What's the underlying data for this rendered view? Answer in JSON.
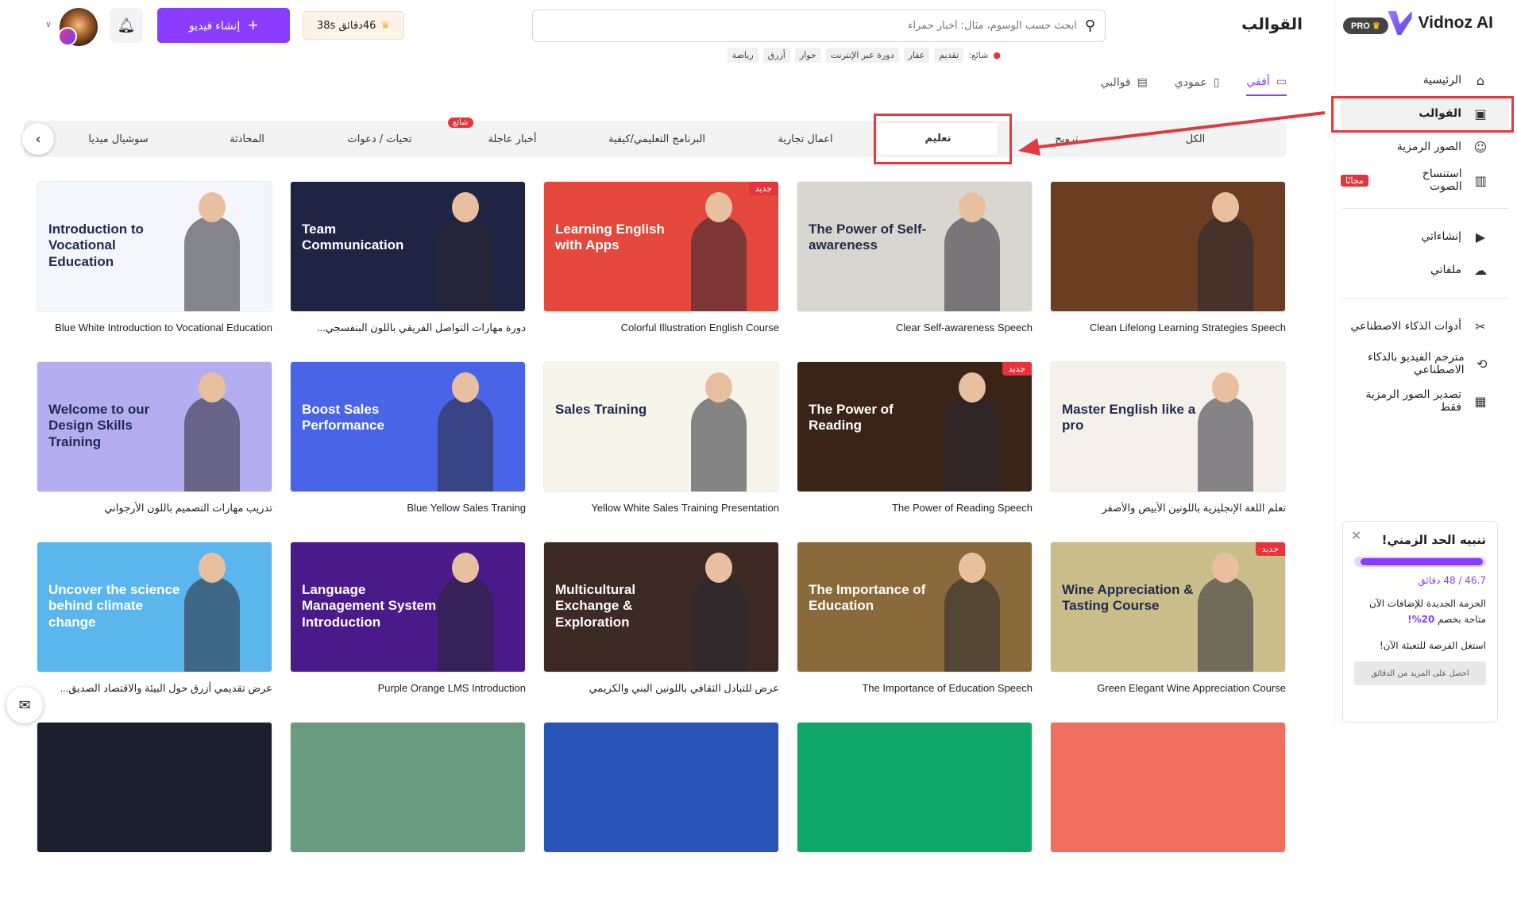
{
  "app": {
    "logo": "Vidnoz AI",
    "pro": "PRO",
    "page_title": "القوالب"
  },
  "search": {
    "placeholder": "ابحث حسب الوسوم، مثال: أخبار حمراء",
    "trending_label": "شائع:",
    "tags": [
      "تقديم",
      "عقار",
      "دورة عبر الإنترنت",
      "حوار",
      "أزرق",
      "رياضة"
    ]
  },
  "header": {
    "credits": "46دقائق 38s",
    "create_label": "إنشاء فيديو"
  },
  "sidebar": {
    "items": [
      {
        "label": "الرئيسية",
        "icon": "home-icon",
        "glyph": "⌂"
      },
      {
        "label": "القوالب",
        "icon": "templates-icon",
        "glyph": "▣",
        "active": true
      },
      {
        "label": "الصور الرمزية",
        "icon": "avatar-icon",
        "glyph": "☺"
      },
      {
        "label": "استنساخ الصوت",
        "icon": "voice-icon",
        "glyph": "▥",
        "badge": "مجانًا"
      },
      {
        "label": "إنشاءاتي",
        "icon": "play-icon",
        "glyph": "▶"
      },
      {
        "label": "ملفاتي",
        "icon": "upload-cloud-icon",
        "glyph": "☁"
      },
      {
        "label": "أدوات الذكاء الاصطناعي",
        "icon": "tools-icon",
        "glyph": "✂"
      },
      {
        "label": "مترجم الفيديو بالذكاء الاصطناعي",
        "icon": "translate-icon",
        "glyph": "⟲"
      },
      {
        "label": "تصدير الصور الرمزية فقط",
        "icon": "export-avatar-icon",
        "glyph": "▦"
      }
    ]
  },
  "orientation": [
    {
      "label": "أفقي",
      "active": true
    },
    {
      "label": "عمودي"
    },
    {
      "label": "قوالبي"
    }
  ],
  "categories": [
    {
      "label": "الكل"
    },
    {
      "label": "ترويج"
    },
    {
      "label": "تعليم",
      "active": true
    },
    {
      "label": "اعمال تجارية"
    },
    {
      "label": "البرنامج التعليمي/كيفية"
    },
    {
      "label": "أخبار عاجلة",
      "badge": "شائع"
    },
    {
      "label": "تحيات / دعوات"
    },
    {
      "label": "المحادثة"
    },
    {
      "label": "سوشيال ميديا"
    }
  ],
  "templates": [
    {
      "title": "Clean Lifelong Learning Strategies Speech",
      "bg": "#6b3d22",
      "thumb_text": "",
      "ltr": true
    },
    {
      "title": "Clear Self-awareness Speech",
      "bg": "#d9d5cf",
      "thumb_text": "The Power of Self-awareness",
      "ltr": true
    },
    {
      "title": "Colorful Illustration English Course",
      "bg": "#e4483c",
      "thumb_text": "Learning English with Apps",
      "new": "جديد",
      "ltr": true
    },
    {
      "title": "دورة مهارات التواصل الفريقي باللون البنفسجي...",
      "bg": "#1f2344",
      "thumb_text": "Team Communication"
    },
    {
      "title": "Blue White Introduction to Vocational Education",
      "bg": "#f4f6fb",
      "thumb_text": "Introduction to Vocational Education",
      "ltr": true
    },
    {
      "title": "تعلم اللغة الإنجليزية باللونين الأبيض والأصفر",
      "bg": "#f5f1ea",
      "thumb_text": "Master English like a pro"
    },
    {
      "title": "The Power of Reading Speech",
      "bg": "#3a2418",
      "thumb_text": "The Power of Reading",
      "new": "جديد",
      "ltr": true
    },
    {
      "title": "Yellow White Sales Training Presentation",
      "bg": "#f7f4ea",
      "thumb_text": "Sales Training",
      "ltr": true
    },
    {
      "title": "Blue Yellow Sales Traning",
      "bg": "#4a64e8",
      "thumb_text": "Boost Sales Performance",
      "ltr": true
    },
    {
      "title": "تدريب مهارات التصميم باللون الأرجواني",
      "bg": "#b4aef0",
      "thumb_text": "Welcome to our Design Skills Training"
    },
    {
      "title": "Green Elegant Wine Appreciation Course",
      "bg": "#c9bd8a",
      "thumb_text": "Wine Appreciation & Tasting Course",
      "new": "جديد",
      "ltr": true
    },
    {
      "title": "The Importance of Education Speech",
      "bg": "#8a6a3a",
      "thumb_text": "The Importance of Education",
      "ltr": true
    },
    {
      "title": "عرض للتبادل الثقافي باللونين البني والكريمي",
      "bg": "#3d2a24",
      "thumb_text": "Multicultural Exchange & Exploration"
    },
    {
      "title": "Purple Orange LMS Introduction",
      "bg": "#4b1a8a",
      "thumb_text": "Language Management System Introduction",
      "ltr": true
    },
    {
      "title": "عرض تقديمي أزرق حول البيئة والاقتصاد الصديق...",
      "bg": "#5cb6ee",
      "thumb_text": "Uncover the science behind climate change"
    },
    {
      "title": "",
      "bg": "#f07060",
      "thumb_text": ""
    },
    {
      "title": "",
      "bg": "#0fa86a",
      "thumb_text": ""
    },
    {
      "title": "",
      "bg": "#2a55b8",
      "thumb_text": ""
    },
    {
      "title": "",
      "bg": "#6a9a80",
      "thumb_text": ""
    },
    {
      "title": "",
      "bg": "#1c1f2e",
      "thumb_text": ""
    }
  ],
  "time_alert": {
    "title": "تنبيه الحد الزمني!",
    "progress_fraction": 0.973,
    "usage": "46.7 / 48 دقائق",
    "message": "الحزمة الجديدة للإضافات الآن متاحة بخصم",
    "discount": "20%!",
    "cta_text": "استغل الفرصة للتعبئة الآن!",
    "button": "احصل على المزيد من الدقائق"
  },
  "colors": {
    "accent": "#8b3dff",
    "badge_red": "#e5343a",
    "annotation_red": "#e0393e"
  }
}
